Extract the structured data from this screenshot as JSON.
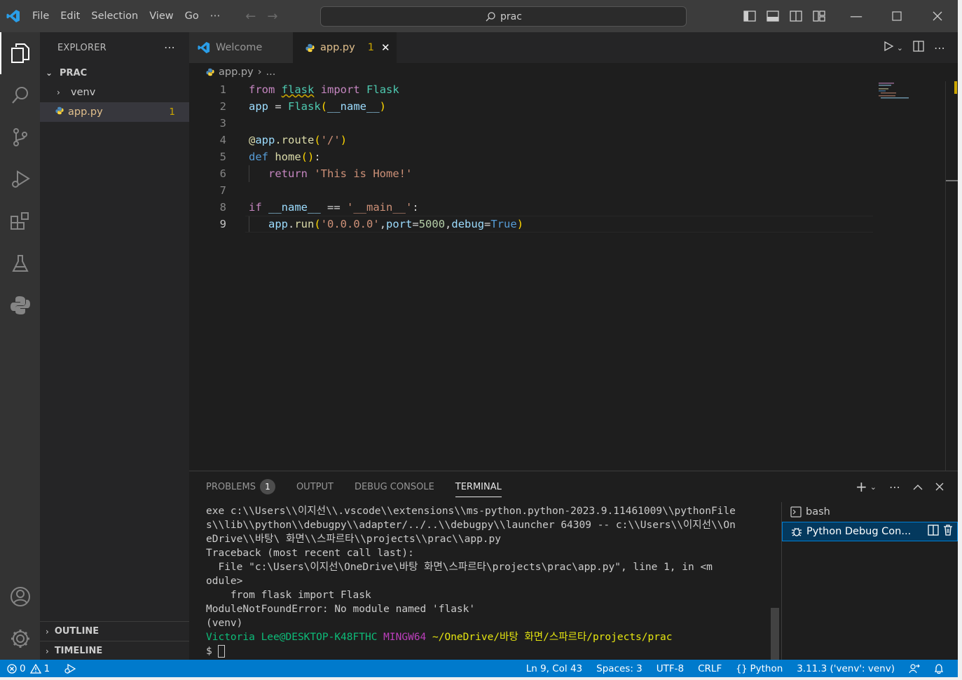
{
  "titlebar": {
    "menu": [
      "File",
      "Edit",
      "Selection",
      "View",
      "Go",
      "⋯"
    ],
    "search": "prac"
  },
  "sidebar": {
    "title": "EXPLORER",
    "folder": "PRAC",
    "items": [
      {
        "label": "venv"
      },
      {
        "label": "app.py",
        "badge": "1"
      }
    ],
    "outline": "OUTLINE",
    "timeline": "TIMELINE"
  },
  "tabs": [
    {
      "label": "Welcome"
    },
    {
      "label": "app.py",
      "badge": "1"
    }
  ],
  "breadcrumb": {
    "file": "app.py",
    "rest": "..."
  },
  "editor": {
    "line_numbers": [
      "1",
      "2",
      "3",
      "4",
      "5",
      "6",
      "7",
      "8",
      "9"
    ],
    "lines": [
      "from flask import Flask",
      "app = Flask(__name__)",
      "",
      "@app.route('/')",
      "def home():",
      "   return 'This is Home!'",
      "",
      "if __name__ == '__main__':",
      "   app.run('0.0.0.0',port=5000,debug=True)"
    ]
  },
  "panel": {
    "tabs": [
      "PROBLEMS",
      "OUTPUT",
      "DEBUG CONSOLE",
      "TERMINAL"
    ],
    "problems_count": "1",
    "terminal_lines": [
      "exe c:\\\\Users\\\\이지선\\\\.vscode\\\\extensions\\\\ms-python.python-2023.9.11461009\\\\pythonFile",
      "s\\\\lib\\\\python\\\\debugpy\\\\adapter/../..\\\\debugpy\\\\launcher 64309 -- c:\\\\Users\\\\이지선\\\\On",
      "eDrive\\\\바탕\\ 화면\\\\스파르타\\\\projects\\\\prac\\\\app.py",
      "Traceback (most recent call last):",
      "  File \"c:\\Users\\이지선\\OneDrive\\바탕 화면\\스파르타\\projects\\prac\\app.py\", line 1, in <m",
      "odule>",
      "    from flask import Flask",
      "ModuleNotFoundError: No module named 'flask'",
      "(venv)"
    ],
    "prompt_user": "Victoria Lee@DESKTOP-K48FTHC",
    "prompt_shell": "MINGW64",
    "prompt_path": "~/OneDrive/바탕 화면/스파르타/projects/prac",
    "prompt_symbol": "$",
    "terminals": [
      "bash",
      "Python Debug Con..."
    ]
  },
  "statusbar": {
    "errors": "0",
    "warnings": "1",
    "position": "Ln 9, Col 43",
    "spaces": "Spaces: 3",
    "encoding": "UTF-8",
    "eol": "CRLF",
    "language": "Python",
    "interpreter": "3.11.3 ('venv': venv)"
  },
  "colors": {
    "accent": "#007acc",
    "modified": "#e2c08d",
    "warning": "#cca700"
  }
}
